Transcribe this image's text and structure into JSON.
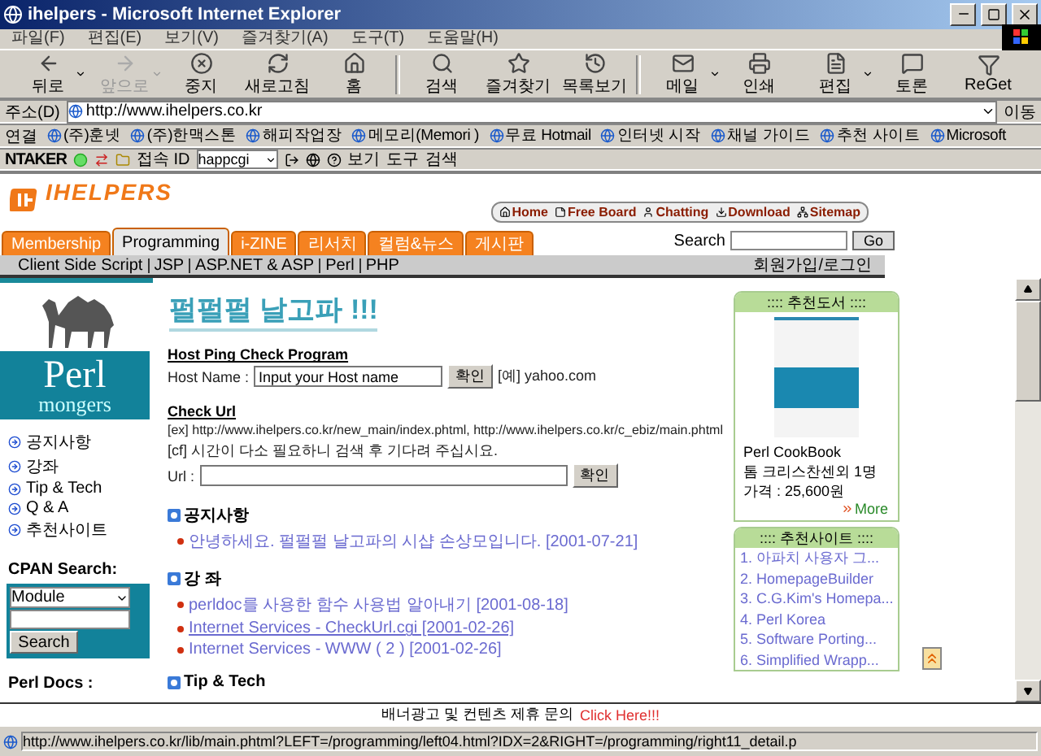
{
  "window": {
    "title": "ihelpers - Microsoft Internet Explorer"
  },
  "menu": [
    "파일(F)",
    "편집(E)",
    "보기(V)",
    "즐겨찾기(A)",
    "도구(T)",
    "도움말(H)"
  ],
  "toolbar": [
    {
      "label": "뒤로",
      "disabled": false,
      "dropdown": true
    },
    {
      "label": "앞으로",
      "disabled": true,
      "dropdown": true
    },
    {
      "label": "중지",
      "disabled": false,
      "dropdown": false
    },
    {
      "label": "새로고침",
      "disabled": false,
      "dropdown": false
    },
    {
      "label": "홈",
      "disabled": false,
      "dropdown": false
    },
    {
      "label": "검색",
      "disabled": false,
      "dropdown": false
    },
    {
      "label": "즐겨찾기",
      "disabled": false,
      "dropdown": false
    },
    {
      "label": "목록보기",
      "disabled": false,
      "dropdown": false
    },
    {
      "label": "메일",
      "disabled": false,
      "dropdown": true
    },
    {
      "label": "인쇄",
      "disabled": false,
      "dropdown": false
    },
    {
      "label": "편집",
      "disabled": false,
      "dropdown": true
    },
    {
      "label": "토론",
      "disabled": false,
      "dropdown": false
    },
    {
      "label": "ReGet",
      "disabled": false,
      "dropdown": false
    }
  ],
  "address": {
    "label": "주소(D)",
    "value": "http://www.ihelpers.co.kr",
    "go": "이동"
  },
  "links": {
    "label": "연결",
    "items": [
      "(주)훈넷",
      "(주)한맥스톤",
      "해피작업장",
      "메모리(Memori )",
      "무료 Hotmail",
      "인터넷 시작",
      "채널 가이드",
      "추천 사이트",
      "Microsoft"
    ]
  },
  "ntaker": {
    "brand": "NTAKER",
    "id_label": "접속 ID",
    "id_value": "happcgi",
    "items": [
      "보기",
      "도구",
      "검색"
    ]
  },
  "site": {
    "logo": "IHELPERS",
    "top_links": [
      "Home",
      "Free Board",
      "Chatting",
      "Download",
      "Sitemap"
    ],
    "tabs": [
      {
        "label": "Membership",
        "selected": false
      },
      {
        "label": "Programming",
        "selected": true
      },
      {
        "label": "i-ZINE",
        "selected": false
      },
      {
        "label": "리서치",
        "selected": false
      },
      {
        "label": "컬럼&뉴스",
        "selected": false
      },
      {
        "label": "게시판",
        "selected": false
      }
    ],
    "search": {
      "label": "Search",
      "button": "Go"
    },
    "subnav": [
      "Client Side Script",
      "JSP",
      "ASP.NET & ASP",
      "Perl",
      "PHP"
    ],
    "login": "회원가입/로그인"
  },
  "left": {
    "brand": "Perl",
    "brand_sub": "mongers",
    "menu": [
      "공지사항",
      "강좌",
      "Tip & Tech",
      "Q & A",
      "추천사이트"
    ],
    "cpan": {
      "title": "CPAN Search:",
      "select": "Module",
      "button": "Search"
    },
    "docs": "Perl Docs :"
  },
  "main": {
    "title": "펄펄펄 날고파 !!!",
    "host_ping": {
      "title": "Host Ping Check Program",
      "label": "Host Name :",
      "value": "Input your Host name",
      "button": "확인",
      "example": "[예] yahoo.com"
    },
    "check_url": {
      "title": "Check Url",
      "lines": [
        "[ex] http://www.ihelpers.co.kr/new_main/index.phtml, http://www.ihelpers.co.kr/c_ebiz/main.phtml",
        "[cf] 시간이 다소 필요하니 검색 후 기다려 주십시요."
      ],
      "label": "Url :",
      "button": "확인"
    },
    "sections": [
      {
        "title": "공지사항",
        "items": [
          {
            "text": "안녕하세요. 펄펄펄 날고파의 시샵 손상모입니다. [2001-07-21]",
            "hovered": false
          }
        ]
      },
      {
        "title": "강 좌",
        "items": [
          {
            "text": "perldoc를 사용한 함수 사용법 알아내기 [2001-08-18]",
            "hovered": false
          },
          {
            "text": "Internet Services - CheckUrl.cgi [2001-02-26]",
            "hovered": true
          },
          {
            "text": "Internet Services - WWW ( 2 ) [2001-02-26]",
            "hovered": false
          }
        ]
      },
      {
        "title": "Tip & Tech"
      }
    ]
  },
  "right": {
    "books": {
      "title": ":::: 추천도서 ::::",
      "name": "Perl CookBook",
      "author": "톰 크리스찬센외 1명",
      "price": "가격 : 25,600원",
      "more": "More"
    },
    "sites": {
      "title": ":::: 추천사이트 ::::",
      "items": [
        "1. 아파치 사용자 그...",
        "2. HomepageBuilder",
        "3. C.G.Kim's Homepa...",
        "4. Perl Korea",
        "5. Software Porting...",
        "6. Simplified Wrapp..."
      ]
    }
  },
  "banner": {
    "text": "배너광고 및 컨텐츠 제휴 문의",
    "link": "Click Here!!!"
  },
  "status_bar": {
    "url": "http://www.ihelpers.co.kr/lib/main.phtml?LEFT=/programming/left04.html?IDX=2&RIGHT=/programming/right11_detail.p"
  }
}
